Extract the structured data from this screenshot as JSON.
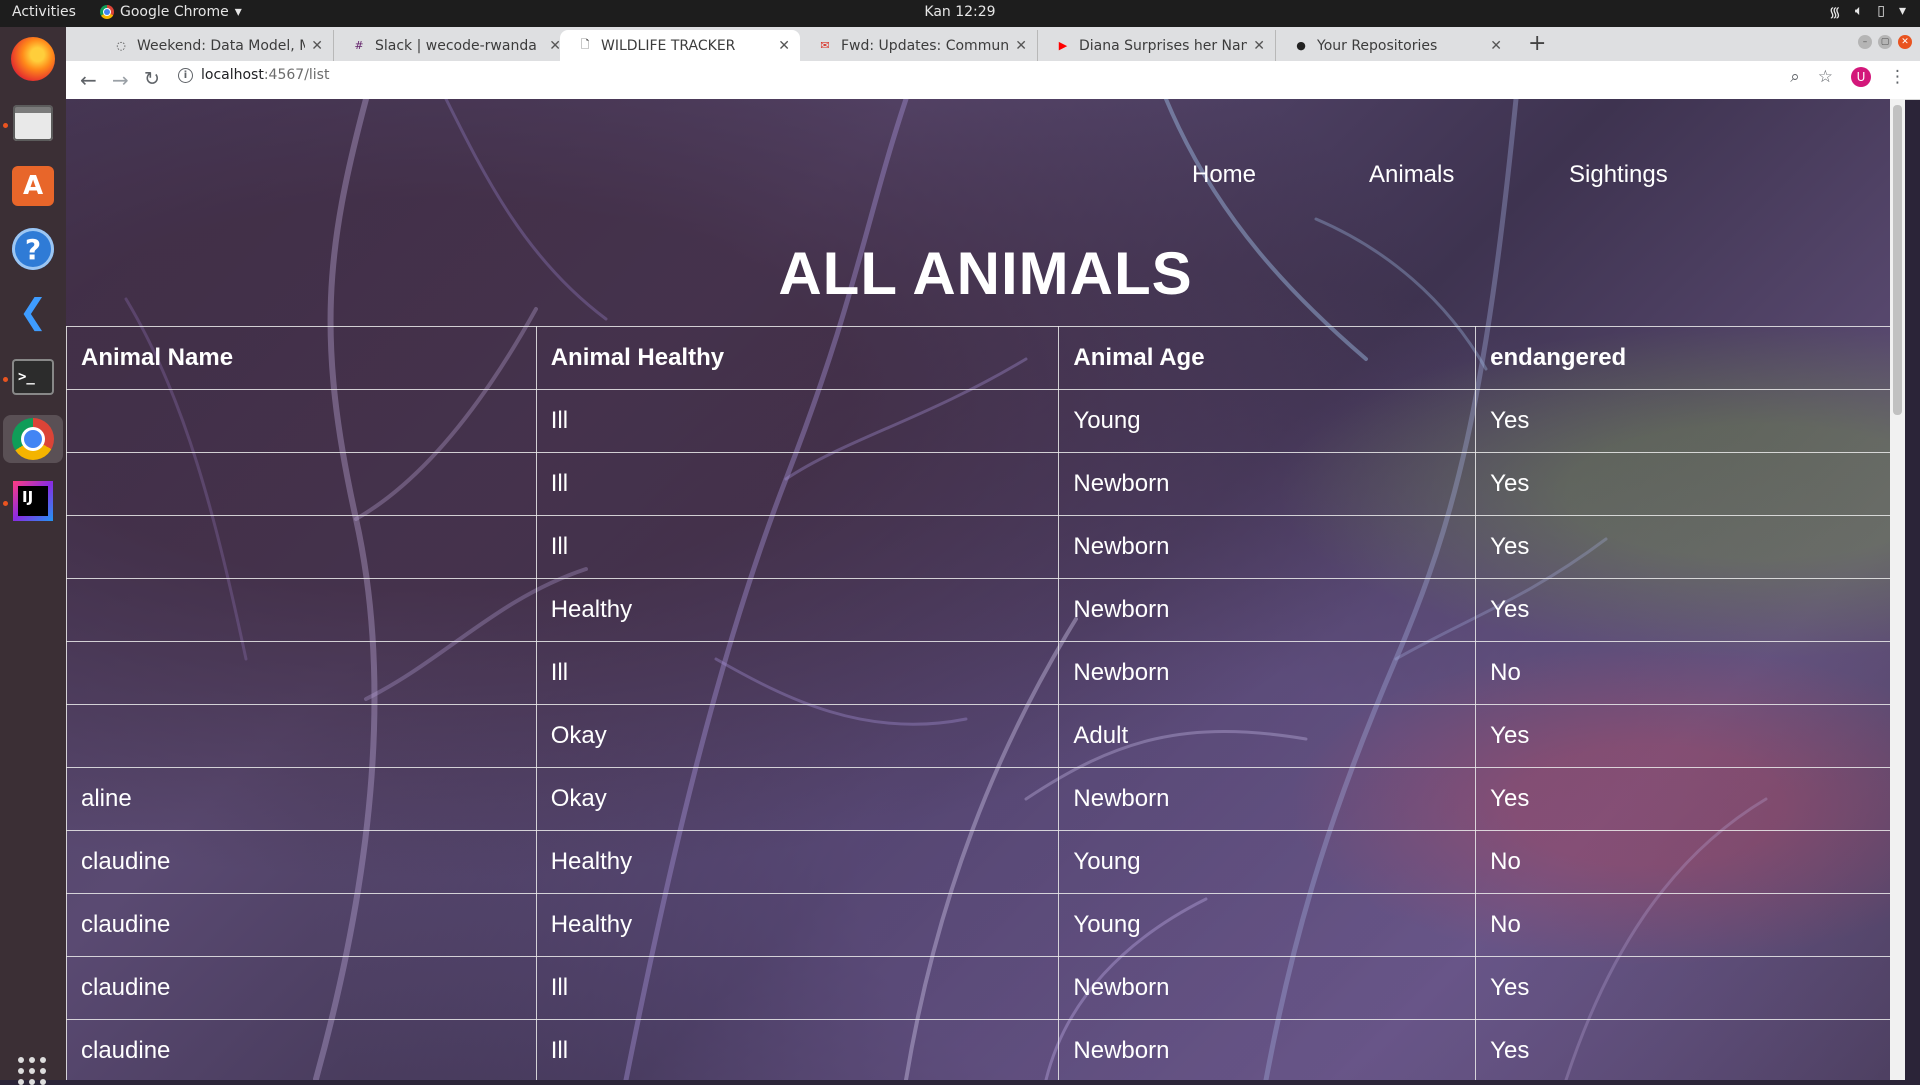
{
  "desktop": {
    "activities": "Activities",
    "app_menu": "Google Chrome",
    "clock": "Kan 12:29"
  },
  "browser": {
    "tabs": [
      {
        "title": "Weekend: Data Model, M",
        "active": false,
        "favicon": "spinner-icon"
      },
      {
        "title": "Slack | wecode-rwanda | M",
        "active": false,
        "favicon": "slack-icon"
      },
      {
        "title": "WILDLIFE TRACKER",
        "active": true,
        "favicon": "page-icon"
      },
      {
        "title": "Fwd: Updates: Communic",
        "active": false,
        "favicon": "gmail-icon"
      },
      {
        "title": "Diana Surprises her Nann",
        "active": false,
        "favicon": "youtube-icon"
      },
      {
        "title": "Your Repositories",
        "active": false,
        "favicon": "github-icon"
      }
    ],
    "url_host": "localhost",
    "url_path": ":4567/list",
    "avatar_letter": "U"
  },
  "page": {
    "nav": {
      "home": "Home",
      "animals": "Animals",
      "sightings": "Sightings"
    },
    "title": "ALL ANIMALS",
    "table": {
      "headers": [
        "Animal Name",
        "Animal Healthy",
        "Animal Age",
        "endangered"
      ],
      "rows": [
        [
          "",
          "Ill",
          "Young",
          "Yes"
        ],
        [
          "",
          "Ill",
          "Newborn",
          "Yes"
        ],
        [
          "",
          "Ill",
          "Newborn",
          "Yes"
        ],
        [
          "",
          "Healthy",
          "Newborn",
          "Yes"
        ],
        [
          "",
          "Ill",
          "Newborn",
          "No"
        ],
        [
          "",
          "Okay",
          "Adult",
          "Yes"
        ],
        [
          "aline",
          "Okay",
          "Newborn",
          "Yes"
        ],
        [
          "claudine",
          "Healthy",
          "Young",
          "No"
        ],
        [
          "claudine",
          "Healthy",
          "Young",
          "No"
        ],
        [
          "claudine",
          "Ill",
          "Newborn",
          "Yes"
        ],
        [
          "claudine",
          "Ill",
          "Newborn",
          "Yes"
        ]
      ]
    }
  },
  "colors": {
    "ubuntu_accent": "#e95420",
    "text": "#ffffff"
  }
}
